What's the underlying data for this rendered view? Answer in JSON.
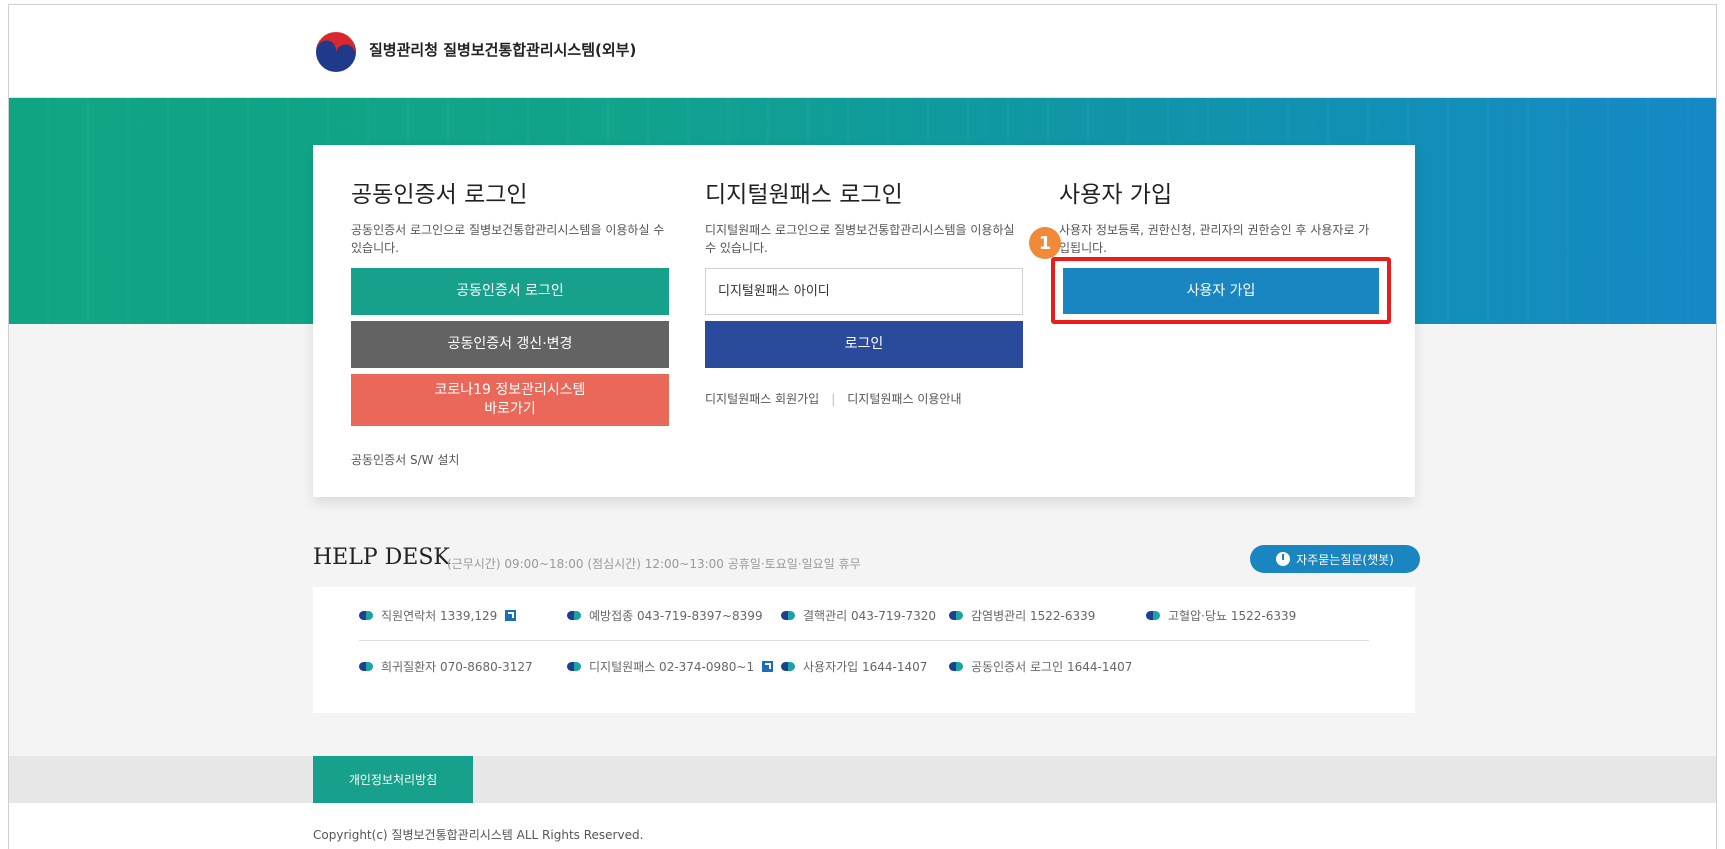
{
  "header": {
    "site_title": "질병관리청 질병보건통합관리시스템(외부)"
  },
  "cert_login": {
    "title": "공동인증서 로그인",
    "desc": "공동인증서 로그인으로 질병보건통합관리시스템을 이용하실 수 있습니다.",
    "login_button": "공동인증서 로그인",
    "renew_button": "공동인증서 갱신·변경",
    "covid_button_line1": "코로나19 정보관리시스템",
    "covid_button_line2": "바로가기",
    "sw_install_link": "공동인증서 S/W 설치"
  },
  "digital_pass": {
    "title": "디지털원패스 로그인",
    "desc": "디지털원패스 로그인으로 질병보건통합관리시스템을 이용하실수 있습니다.",
    "id_placeholder": "디지털원패스 아이디",
    "login_button": "로그인",
    "join_link": "디지털원패스 회원가입",
    "separator": "|",
    "guide_link": "디지털원패스 이용안내"
  },
  "signup": {
    "title": "사용자 가입",
    "desc": "사용자 정보등록, 권한신청, 관리자의 권한승인 후 사용자로 가입됩니다.",
    "button": "사용자 가입",
    "step_badge": "1"
  },
  "help_desk": {
    "title": "HELP DESK",
    "hours": "(근무시간) 09:00~18:00 (점심시간) 12:00~13:00 공휴일·토요일·일요일 휴무",
    "chatbot_button": "자주묻는질문(챗봇)",
    "contacts_row1": [
      {
        "label": "직원연락처 1339,129",
        "external": true
      },
      {
        "label": "예방접종 043-719-8397~8399",
        "external": false
      },
      {
        "label": "결핵관리 043-719-7320",
        "external": false
      },
      {
        "label": "감염병관리 1522-6339",
        "external": false
      },
      {
        "label": "고혈압·당뇨 1522-6339",
        "external": false
      }
    ],
    "contacts_row2": [
      {
        "label": "희귀질환자 070-8680-3127",
        "external": false
      },
      {
        "label": "디지털원패스 02-374-0980~1",
        "external": true
      },
      {
        "label": "사용자가입 1644-1407",
        "external": false
      },
      {
        "label": "공동인증서 로그인 1644-1407",
        "external": false
      }
    ]
  },
  "footer": {
    "privacy_link": "개인정보처리방침",
    "copyright": "Copyright(c) 질병보건통합관리시스템 ALL Rights Reserved."
  },
  "colors": {
    "teal": "#17a08c",
    "gray": "#636363",
    "red": "#e9685a",
    "navy": "#2a4b9b",
    "blue": "#1a86c1",
    "highlight": "#ee1b1b",
    "badge": "#f08a3a"
  },
  "icons": {
    "logo": "kdca-taegeuk-logo",
    "chatbot": "chatbot-icon",
    "external": "external-link-icon",
    "bullet": "bullet-dot-icon"
  }
}
